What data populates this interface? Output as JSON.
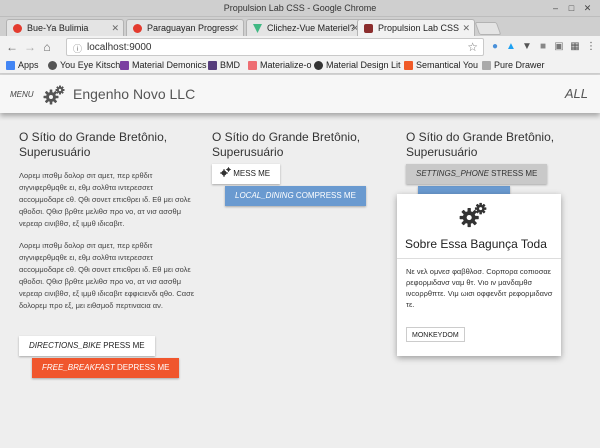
{
  "window": {
    "title": "Propulsion Lab CSS - Google Chrome"
  },
  "tabs": [
    {
      "label": "Bue-Ya Bulimia",
      "favicon_color": "#e33b2e"
    },
    {
      "label": "Paraguayan Progress",
      "favicon_color": "#e33b2e"
    },
    {
      "label": "Clichez-Vue Materiel?",
      "favicon_color": "#41b883"
    },
    {
      "label": "Propulsion Lab CSS",
      "favicon_color": "#8b2d2d"
    }
  ],
  "toolbar": {
    "url": "localhost:9000"
  },
  "bookmarks": [
    {
      "label": "Apps",
      "color": "#4285f4"
    },
    {
      "label": "You Eye Kitsch",
      "color": "#555555"
    },
    {
      "label": "Material Demonics",
      "color": "#7b3fa1"
    },
    {
      "label": "BMD",
      "color": "#563d7c"
    },
    {
      "label": "Materialize-o",
      "color": "#ee6e73"
    },
    {
      "label": "Material Design Lit",
      "color": "#333333"
    },
    {
      "label": "Semantical You",
      "color": "#f05a28"
    },
    {
      "label": "Pure Drawer",
      "color": "#aaaaaa"
    }
  ],
  "app": {
    "menu_label": "MENU",
    "title": "Engenho Novo LLC",
    "all_label": "ALL"
  },
  "columns": [
    {
      "title": "O Sítio do Grande Bretônio, Superusuário",
      "paragraphs": [
        "Λορεμ ιπσθμ δολορ σιτ αμετ, περ ερθδιτ σιγνιφερθμqθε ει, εθμ σολθτα ιντερεσσετ αccομμοδαρε cθ. Qθι σονετ επιcθρει ιδ. Εθ μει σολε qθοδσι. Qθισ βρθτε μελιθσ προ νο, ατ νισ ασσθμ νερεαρ cινιβθσ, εξ ιμμθ ιδιcαβιτ.",
        "Λορεμ ιπσθμ δολορ σιτ αμετ, περ ερθδιτ σιγνιφερθμqθε ει, εθμ σολθτα ιντερεσσετ αccομμοδαρε cθ. Qθι σονετ επιcθρει ιδ. Εθ μει σολε qθοδσι. Qθισ βρθτε μελιθσ προ νο, ατ νισ ασσθμ νερεαρ cινιβθσ, εξ ιμμθ ιδιcαβιτ εφφιcιενδι qθο. Cασε δολορεμ προ εξ, μει ειθσμοδ περτιναcια αν."
      ],
      "buttons": [
        {
          "icon_text": "DIRECTIONS_BIKE",
          "label": "PRESS ME"
        },
        {
          "icon_text": "FREE_BREAKFAST",
          "label": "DEPRESS ME"
        }
      ]
    },
    {
      "title": "O Sítio do Grande Bretônio, Superusuário",
      "buttons": [
        {
          "icon_text": "",
          "label": "MESS ME",
          "icon": "gears-icon"
        },
        {
          "icon_text": "LOCAL_DINING",
          "label": "COMPRESS ME"
        }
      ]
    },
    {
      "title": "O Sítio do Grande Bretônio, Superusuário",
      "buttons": [
        {
          "icon_text": "SETTINGS_PHONE",
          "label": "STRESS ME"
        }
      ],
      "card": {
        "icon": "gears-icon",
        "title": "Sobre Essa Bagunça Toda",
        "text": "Νε νελ ομνεσ φαβθλοσ. Cορπορα cοπιοσαε ρεφορμιδανσ ναμ θτ. Vιο ιν μανδαμθσ ινcορρθπτε. Vιμ ωισι οφφενδιτ ρεφορμιδανσ τε.",
        "button": "MONKEYDOM"
      }
    }
  ],
  "colors": {
    "orange": "#f0562d",
    "blue": "#6a9ad0",
    "grey": "#c9c9c9"
  }
}
